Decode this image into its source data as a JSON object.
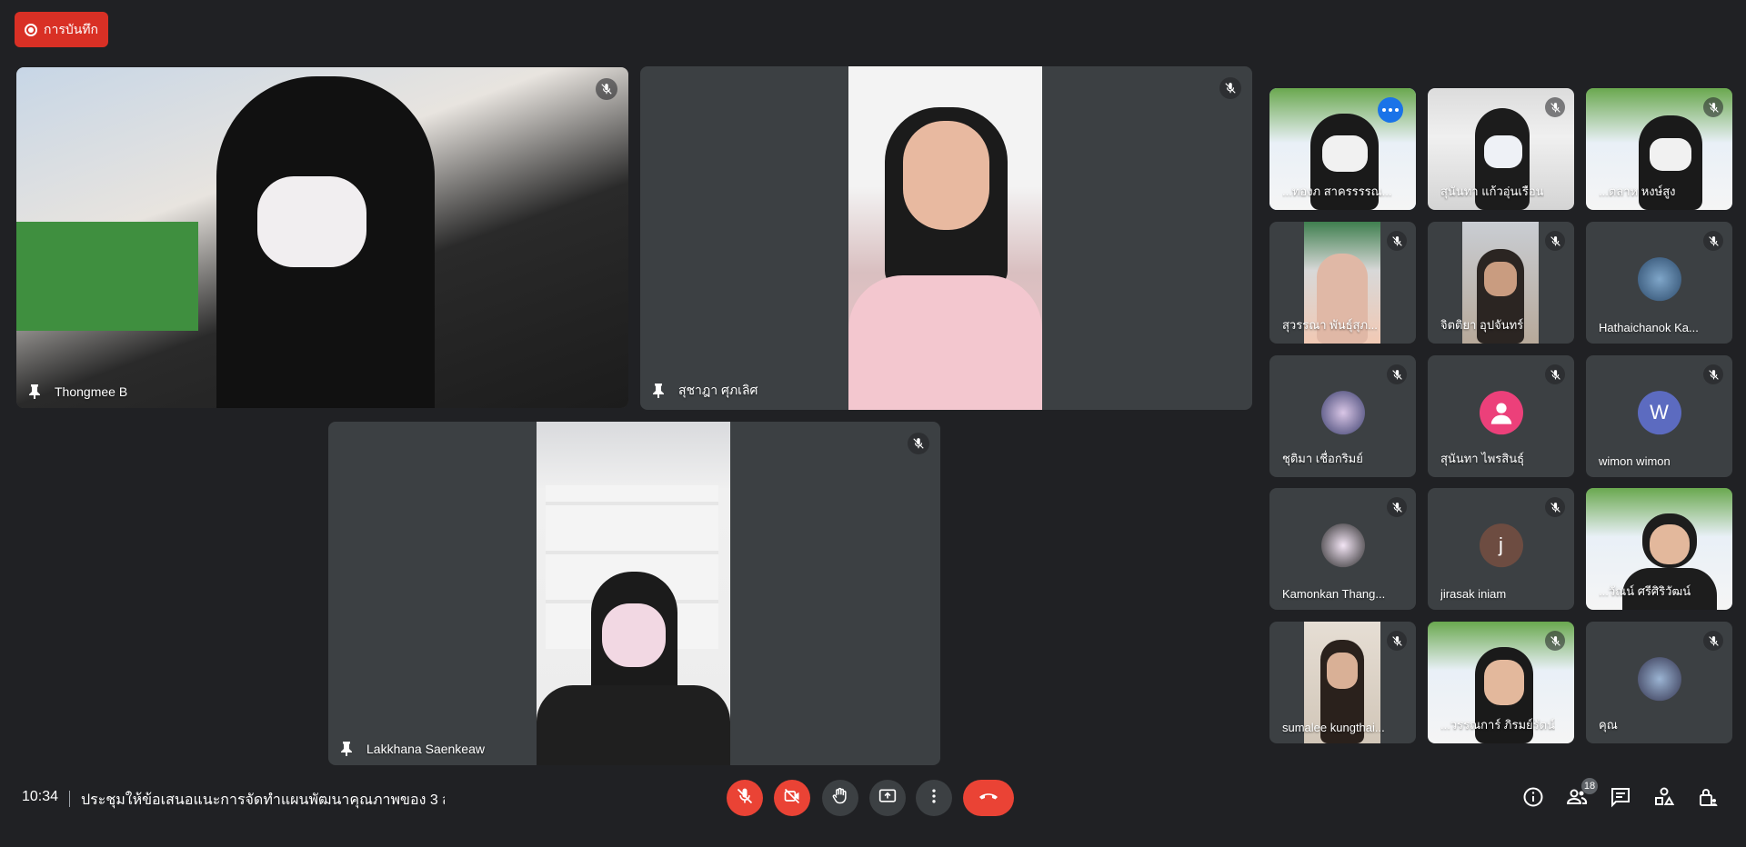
{
  "recording": {
    "label": "การบันทึก",
    "color": "#d93025"
  },
  "main_tiles": [
    {
      "name": "Thongmee B"
    },
    {
      "name": "สุชาฎา ศุภเลิศ"
    },
    {
      "name": "Lakkhana Saenkeaw"
    }
  ],
  "side_tiles": [
    {
      "name": "...ทองภ สาครรรรณ...",
      "type": "video"
    },
    {
      "name": "สุนันทา แก้วอุ่นเรือน",
      "type": "video"
    },
    {
      "name": "...ตลาห หงษ์สูง",
      "type": "video"
    },
    {
      "name": "สุวรรณา พันธุ์สุภ...",
      "type": "video"
    },
    {
      "name": "จิตติยา อุปจันทร์",
      "type": "video"
    },
    {
      "name": "Hathaichanok Ka...",
      "type": "avatar"
    },
    {
      "name": "ชุติมา เชื่อกริมย์",
      "type": "avatar"
    },
    {
      "name": "สุนันทา ไพรสินธุ์",
      "type": "avatar"
    },
    {
      "name": "wimon wimon",
      "type": "avatar",
      "initial": "W",
      "avatar_color": "#5c6bc0"
    },
    {
      "name": "Kamonkan Thang...",
      "type": "avatar"
    },
    {
      "name": "jirasak iniam",
      "type": "avatar",
      "initial": "j",
      "avatar_color": "#6d4c41"
    },
    {
      "name": "...วัณน์ ศรีศิริวัฒน์",
      "type": "video"
    },
    {
      "name": "sumalee kungthai...",
      "type": "video"
    },
    {
      "name": "...วรรณการ์ ภิรมย์รัตน์",
      "type": "video"
    },
    {
      "name": "คุณ",
      "type": "avatar"
    }
  ],
  "bottom_bar": {
    "time": "10:34",
    "meeting_title": "ประชุมให้ข้อเสนอแนะการจัดทำแผนพัฒนาคุณภาพของ 3 ส...",
    "participant_count": "18"
  },
  "icons": {
    "mic_off": "mic-off-icon",
    "cam_off": "camera-off-icon",
    "raise_hand": "hand-icon",
    "present": "present-screen-icon",
    "more": "more-vert-icon",
    "end_call": "end-call-icon",
    "info": "info-icon",
    "people": "people-icon",
    "chat": "chat-icon",
    "activities": "activities-icon",
    "host_controls": "lock-person-icon"
  }
}
